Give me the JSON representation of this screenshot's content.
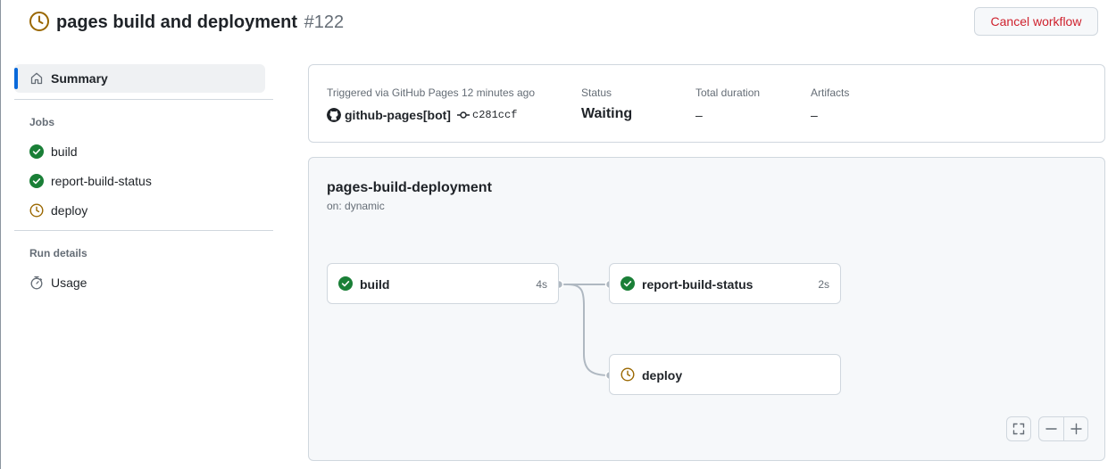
{
  "header": {
    "title": "pages build and deployment",
    "run_number": "#122",
    "cancel_label": "Cancel workflow",
    "status_icon": "clock-icon"
  },
  "sidebar": {
    "summary_label": "Summary",
    "jobs_heading": "Jobs",
    "jobs": [
      {
        "label": "build",
        "status": "success"
      },
      {
        "label": "report-build-status",
        "status": "success"
      },
      {
        "label": "deploy",
        "status": "waiting"
      }
    ],
    "run_details_heading": "Run details",
    "usage_label": "Usage"
  },
  "summary": {
    "trigger_text": "Triggered via GitHub Pages 12 minutes ago",
    "actor": "github-pages[bot]",
    "commit": "c281ccf",
    "status_label": "Status",
    "status_value": "Waiting",
    "duration_label": "Total duration",
    "duration_value": "–",
    "artifacts_label": "Artifacts",
    "artifacts_value": "–"
  },
  "graph": {
    "workflow_name": "pages-build-deployment",
    "trigger": "on: dynamic",
    "nodes": [
      {
        "name": "build",
        "duration": "4s",
        "status": "success"
      },
      {
        "name": "report-build-status",
        "duration": "2s",
        "status": "success"
      },
      {
        "name": "deploy",
        "duration": "",
        "status": "waiting"
      }
    ]
  },
  "colors": {
    "success": "#1a7f37",
    "waiting": "#9a6700",
    "danger": "#cf222e",
    "accent": "#0969da"
  }
}
